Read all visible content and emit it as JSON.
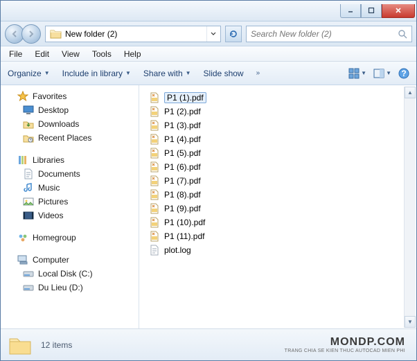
{
  "address": {
    "folder": "New folder (2)"
  },
  "search": {
    "placeholder": "Search New folder (2)"
  },
  "menu": {
    "file": "File",
    "edit": "Edit",
    "view": "View",
    "tools": "Tools",
    "help": "Help"
  },
  "toolbar": {
    "organize": "Organize",
    "include": "Include in library",
    "share": "Share with",
    "slideshow": "Slide show"
  },
  "sidebar": {
    "favorites": {
      "label": "Favorites",
      "items": [
        {
          "label": "Desktop"
        },
        {
          "label": "Downloads"
        },
        {
          "label": "Recent Places"
        }
      ]
    },
    "libraries": {
      "label": "Libraries",
      "items": [
        {
          "label": "Documents"
        },
        {
          "label": "Music"
        },
        {
          "label": "Pictures"
        },
        {
          "label": "Videos"
        }
      ]
    },
    "homegroup": {
      "label": "Homegroup"
    },
    "computer": {
      "label": "Computer",
      "items": [
        {
          "label": "Local Disk (C:)"
        },
        {
          "label": "Du Lieu (D:)"
        }
      ]
    }
  },
  "files": [
    {
      "name": "P1 (1).pdf",
      "type": "pdf",
      "selected": true
    },
    {
      "name": "P1 (2).pdf",
      "type": "pdf"
    },
    {
      "name": "P1 (3).pdf",
      "type": "pdf"
    },
    {
      "name": "P1 (4).pdf",
      "type": "pdf"
    },
    {
      "name": "P1 (5).pdf",
      "type": "pdf"
    },
    {
      "name": "P1 (6).pdf",
      "type": "pdf"
    },
    {
      "name": "P1 (7).pdf",
      "type": "pdf"
    },
    {
      "name": "P1 (8).pdf",
      "type": "pdf"
    },
    {
      "name": "P1 (9).pdf",
      "type": "pdf"
    },
    {
      "name": "P1 (10).pdf",
      "type": "pdf"
    },
    {
      "name": "P1 (11).pdf",
      "type": "pdf"
    },
    {
      "name": "plot.log",
      "type": "log"
    }
  ],
  "status": {
    "count": "12 items"
  },
  "watermark": {
    "big": "MONDP.COM",
    "small": "TRANG CHIA SE KIEN THUC AUTOCAD MIEN PHI"
  }
}
